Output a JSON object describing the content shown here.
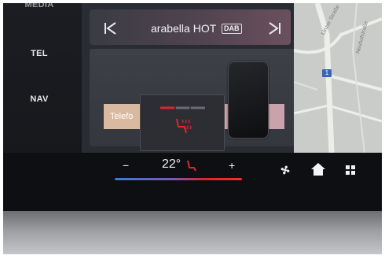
{
  "sidebar": {
    "items": [
      "MEDIA",
      "TEL",
      "NAV"
    ]
  },
  "radio": {
    "station": "arabella HOT",
    "badge": "DAB"
  },
  "card": {
    "tab_label": "Telefo"
  },
  "map": {
    "street": "Linzer Straße",
    "road_number": "1",
    "street2": "Neuhofstraße"
  },
  "climate": {
    "minus_label": "−",
    "temperature": "22°",
    "plus_label": "+",
    "seat_heat_level": 0.35
  },
  "colors": {
    "accent_red": "#e0242a",
    "accent_blue": "#3a7bd5",
    "map_road": "#e8e9e6"
  },
  "icons": [
    "prev-track-icon",
    "next-track-icon",
    "seat-heat-icon",
    "fan-icon",
    "home-icon",
    "apps-grid-icon"
  ]
}
